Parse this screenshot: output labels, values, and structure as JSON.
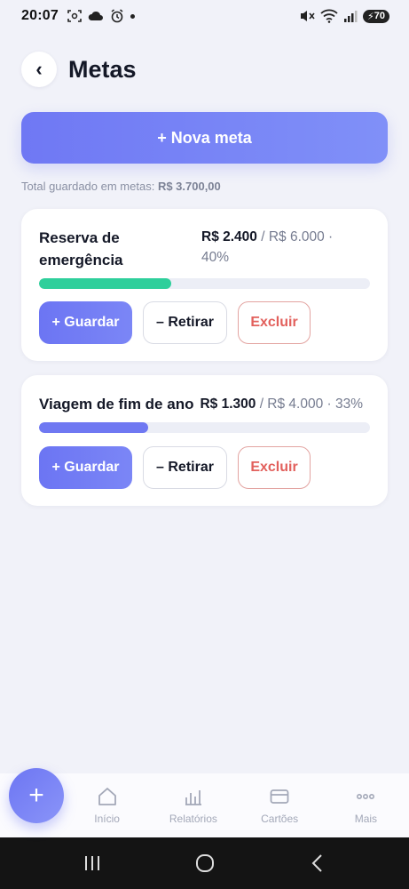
{
  "status_bar": {
    "time": "20:07",
    "battery": "70"
  },
  "header": {
    "back_symbol": "‹",
    "title": "Metas"
  },
  "new_goal_button": "+ Nova meta",
  "total": {
    "label": "Total guardado em metas:",
    "value": "R$ 3.700,00"
  },
  "goals": [
    {
      "name_line1": "Reserva de",
      "name_line2": "emergência",
      "saved": "R$ 2.400",
      "target_line1": " / R$ 6.000 ·",
      "target_line2": "40%",
      "progress": 0.4,
      "color": "#2ecf9b",
      "save_label": "+ Guardar",
      "withdraw_label": "– Retirar",
      "delete_label": "Excluir"
    },
    {
      "name": "Viagem de fim de ano",
      "saved": "R$ 1.300",
      "target": " / R$ 4.000 · 33%",
      "progress": 0.33,
      "color": "#6f78f2",
      "save_label": "+ Guardar",
      "withdraw_label": "– Retirar",
      "delete_label": "Excluir"
    }
  ],
  "fab_label": "+",
  "bottom_nav": [
    {
      "label": "Início",
      "icon": "home-icon"
    },
    {
      "label": "Relatórios",
      "icon": "bar-chart-icon"
    },
    {
      "label": "Cartões",
      "icon": "card-icon"
    },
    {
      "label": "Mais",
      "icon": "more-icon"
    }
  ],
  "colors": {
    "accent": "#6f78f4",
    "danger": "#e2605c",
    "success": "#2ecf9b"
  }
}
